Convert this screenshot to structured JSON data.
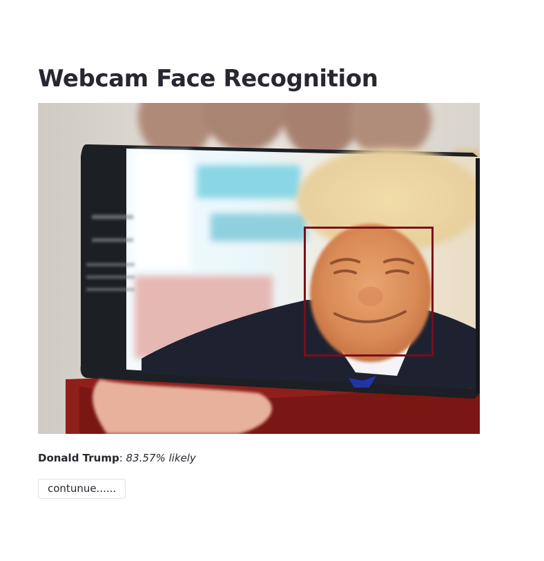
{
  "page": {
    "title": "Webcam Face Recognition"
  },
  "webcam": {
    "image_content": "webcam-frame-phone-photo",
    "detection_box_color": "#7a0d1a"
  },
  "result": {
    "name": "Donald Trump",
    "separator": ": ",
    "probability": "83.57% likely"
  },
  "actions": {
    "continue_label": "contunue......"
  }
}
